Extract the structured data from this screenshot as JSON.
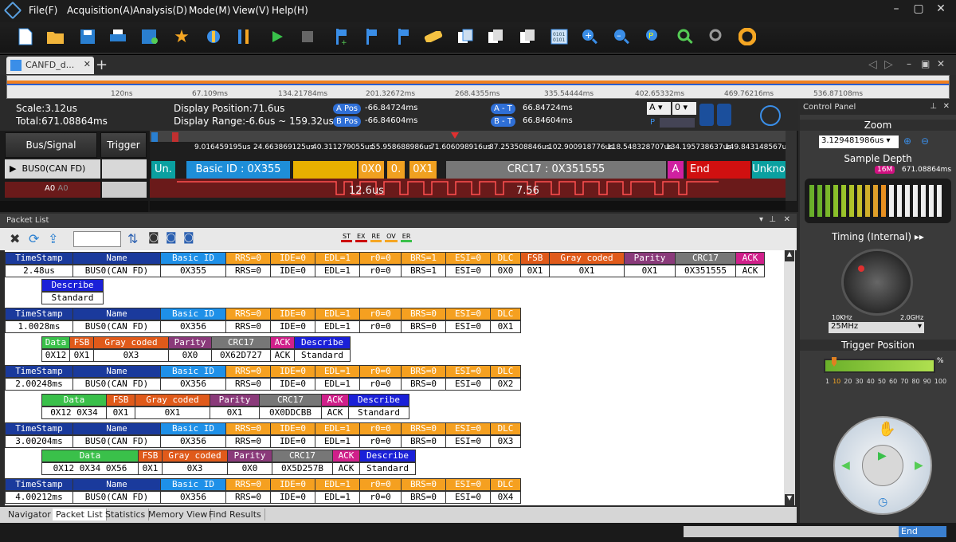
{
  "menu": [
    "File(F)",
    "Acquisition(A)",
    "Analysis(D)",
    "Mode(M)",
    "View(V)",
    "Help(H)"
  ],
  "tab": {
    "label": "CANFD_d..."
  },
  "ruler": [
    "120ns",
    "67.109ms",
    "134.21784ms",
    "201.32672ms",
    "268.4355ms",
    "335.54444ms",
    "402.65332ms",
    "469.76216ms",
    "536.87108ms"
  ],
  "info": {
    "scale": "Scale:3.12us",
    "total": "Total:671.08864ms",
    "disp_pos": "Display Position:71.6us",
    "disp_range": "Display Range:-6.6us ~ 159.32us",
    "apos_label": "A Pos",
    "apos": "-66.84724ms",
    "bpos_label": "B Pos",
    "bpos": "-66.84604ms",
    "at_label": "A - T",
    "at": "66.84724ms",
    "bt_label": "B - T",
    "bt": "66.84604ms",
    "sel_a": "A",
    "sel_0": "0",
    "p": "P"
  },
  "signal": {
    "bus_header": "Bus/Signal",
    "trigger_header": "Trigger",
    "bus0": "BUS0(CAN FD)",
    "a0": "A0",
    "a0b": "A0"
  },
  "wave": {
    "ticks": [
      "9.016459195us",
      "24.663869125us",
      "40.311279055us",
      "55.958688986us",
      "71.606098916us",
      "87.253508846us",
      "102.900918776us",
      "118.548328707us",
      "134.195738637us",
      "149.843148567us"
    ],
    "seg_un": "Un.",
    "seg_basic": "Basic ID : 0X355",
    "seg_0x0": "0X0",
    "seg_0": "0.",
    "seg_0x1": "0X1",
    "seg_crc": "CRC17 : 0X351555",
    "seg_a": "A",
    "seg_end": "End",
    "seg_unk": "Unkno",
    "lbl1": "12.6us",
    "lbl2": "7.56"
  },
  "packet_list": {
    "title": "Packet List",
    "badges": [
      "ST",
      "EX",
      "RE",
      "OV",
      "ER"
    ],
    "h1": [
      "TimeStamp",
      "Name",
      "Basic ID",
      "RRS=0",
      "IDE=0",
      "EDL=1",
      "r0=0",
      "BRS=1",
      "ESI=0",
      "DLC",
      "FSB",
      "Gray coded",
      "Parity",
      "CRC17",
      "ACK"
    ],
    "p1": [
      "2.48us",
      "BUS0(CAN FD)",
      "0X355",
      "RRS=0",
      "IDE=0",
      "EDL=1",
      "r0=0",
      "BRS=1",
      "ESI=0",
      "0X0",
      "0X1",
      "0X1",
      "0X1",
      "0X351555",
      "ACK"
    ],
    "describe_h": "Describe",
    "standard": "Standard",
    "hB": [
      "TimeStamp",
      "Name",
      "Basic ID",
      "RRS=0",
      "IDE=0",
      "EDL=1",
      "r0=0",
      "BRS=0",
      "ESI=0",
      "DLC"
    ],
    "p2": [
      "1.0028ms",
      "BUS0(CAN FD)",
      "0X356",
      "RRS=0",
      "IDE=0",
      "EDL=1",
      "r0=0",
      "BRS=0",
      "ESI=0",
      "0X1"
    ],
    "d2h": [
      "Data",
      "FSB",
      "Gray coded",
      "Parity",
      "CRC17",
      "ACK",
      "Describe"
    ],
    "d2": [
      "0X12",
      "0X1",
      "0X3",
      "0X0",
      "0X62D727",
      "ACK",
      "Standard"
    ],
    "p3": [
      "2.00248ms",
      "BUS0(CAN FD)",
      "0X356",
      "RRS=0",
      "IDE=0",
      "EDL=1",
      "r0=0",
      "BRS=0",
      "ESI=0",
      "0X2"
    ],
    "d3": [
      "0X12  0X34",
      "0X1",
      "0X1",
      "0X1",
      "0X0DDCBB",
      "ACK",
      "Standard"
    ],
    "p4": [
      "3.00204ms",
      "BUS0(CAN FD)",
      "0X356",
      "RRS=0",
      "IDE=0",
      "EDL=1",
      "r0=0",
      "BRS=0",
      "ESI=0",
      "0X3"
    ],
    "d4": [
      "0X12  0X34  0X56",
      "0X1",
      "0X3",
      "0X0",
      "0X5D257B",
      "ACK",
      "Standard"
    ],
    "p5": [
      "4.00212ms",
      "BUS0(CAN FD)",
      "0X356",
      "RRS=0",
      "IDE=0",
      "EDL=1",
      "r0=0",
      "BRS=0",
      "ESI=0",
      "0X4"
    ]
  },
  "bottom_tabs": [
    "Navigator",
    "Packet List",
    "Statistics",
    "Memory View",
    "Find Results"
  ],
  "status": {
    "end": "End"
  },
  "control": {
    "title": "Control Panel",
    "zoom": "Zoom",
    "zoom_val": "3.129481986us",
    "depth": "Sample Depth",
    "depth_badge": "16M",
    "depth_val": "671.08864ms",
    "timing": "Timing (Internal)",
    "k_lo": "10KHz",
    "k_hi": "2.0GHz",
    "rate": "25MHz",
    "trig": "Trigger Position",
    "pct": "%",
    "scale": [
      "1",
      "10",
      "20",
      "30",
      "40",
      "50",
      "60",
      "70",
      "80",
      "90",
      "100"
    ]
  }
}
